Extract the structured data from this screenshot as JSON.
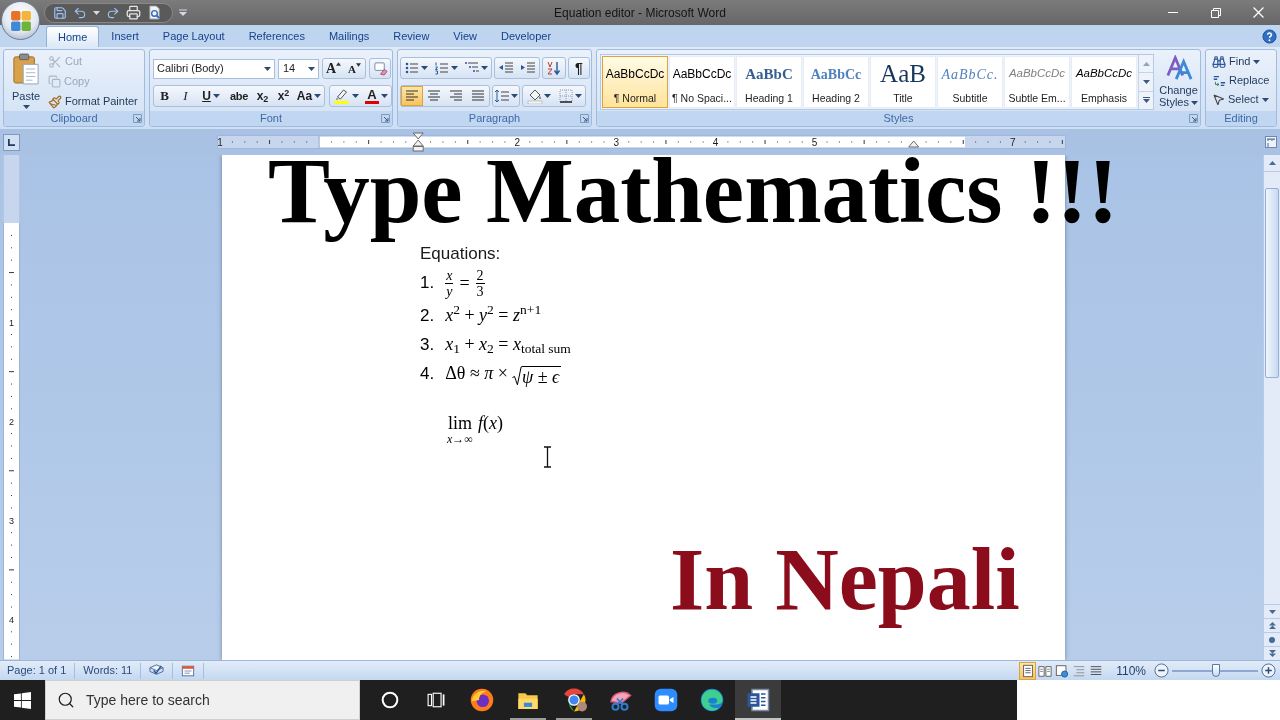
{
  "title_bar": {
    "title": "Equation editor - Microsoft Word"
  },
  "tabs": [
    {
      "label": "Home",
      "selected": true
    },
    {
      "label": "Insert",
      "selected": false
    },
    {
      "label": "Page Layout",
      "selected": false
    },
    {
      "label": "References",
      "selected": false
    },
    {
      "label": "Mailings",
      "selected": false
    },
    {
      "label": "Review",
      "selected": false
    },
    {
      "label": "View",
      "selected": false
    },
    {
      "label": "Developer",
      "selected": false
    }
  ],
  "clipboard": {
    "label": "Clipboard",
    "paste": "Paste",
    "actions": [
      {
        "kind": "cut",
        "label": "Cut",
        "disabled": true
      },
      {
        "kind": "copy",
        "label": "Copy",
        "disabled": true
      },
      {
        "kind": "painter",
        "label": "Format Painter",
        "disabled": false
      }
    ]
  },
  "font": {
    "label": "Font",
    "name": "Calibri (Body)",
    "size": "14",
    "grow": "A",
    "shrink": "A",
    "formats": [
      {
        "kind": "bold",
        "label": "B",
        "dropdown": false
      },
      {
        "kind": "italic",
        "label": "I",
        "dropdown": false
      },
      {
        "kind": "underline",
        "label": "U",
        "dropdown": true
      },
      {
        "kind": "strike",
        "label": "abe",
        "dropdown": false
      },
      {
        "kind": "plain",
        "label": "x$_{2}$",
        "dropdown": false
      },
      {
        "kind": "plain",
        "label": "x$^{2}$",
        "dropdown": false
      },
      {
        "kind": "plain",
        "label": "Aa",
        "dropdown": true
      }
    ],
    "font_color": "A"
  },
  "paragraph": {
    "label": "Paragraph",
    "marks": "¶",
    "alignments": [
      {
        "kind": "left",
        "selected": true
      },
      {
        "kind": "center",
        "selected": false
      },
      {
        "kind": "right",
        "selected": false
      },
      {
        "kind": "justify",
        "selected": false
      }
    ]
  },
  "styles": {
    "label": "Styles",
    "items": [
      {
        "kind": "body",
        "preview": "AaBbCcDc",
        "name": "¶ Normal",
        "selected": true
      },
      {
        "kind": "body",
        "preview": "AaBbCcDc",
        "name": "¶ No Spaci...",
        "selected": false
      },
      {
        "kind": "heading",
        "preview": "AaBbC",
        "name": "Heading 1",
        "selected": false
      },
      {
        "kind": "subheading",
        "preview": "AaBbCc",
        "name": "Heading 2",
        "selected": false
      },
      {
        "kind": "title",
        "preview": "AaB",
        "name": "Title",
        "selected": false
      },
      {
        "kind": "subtitle",
        "preview": "AaBbCc.",
        "name": "Subtitle",
        "selected": false
      },
      {
        "kind": "subtle",
        "preview": "AaBbCcDc",
        "name": "Subtle Em...",
        "selected": false
      },
      {
        "kind": "emphasis",
        "preview": "AaBbCcDc",
        "name": "Emphasis",
        "selected": false
      }
    ],
    "change": "Change Styles"
  },
  "editing": {
    "label": "Editing",
    "items": [
      {
        "kind": "find",
        "label": "Find",
        "dropdown": true
      },
      {
        "kind": "replace",
        "label": "Replace",
        "dropdown": false
      },
      {
        "kind": "select",
        "label": "Select",
        "dropdown": true
      }
    ]
  },
  "ruler": {
    "marks": [
      {
        "kind": "number",
        "label": "1"
      },
      {
        "kind": "margin"
      },
      {
        "kind": "indent"
      },
      {
        "kind": "number",
        "label": "2"
      },
      {
        "kind": "number",
        "label": "3"
      },
      {
        "kind": "number",
        "label": "4"
      },
      {
        "kind": "number",
        "label": "5"
      },
      {
        "kind": "rindent"
      },
      {
        "kind": "number",
        "label": "7"
      }
    ]
  },
  "vertical_ruler": {
    "labels": [
      "1",
      "2",
      "3",
      "4"
    ]
  },
  "document": {
    "title": "Type Mathematics !!!",
    "heading": "Equations:",
    "equations": [
      {
        "number": "1.",
        "kind": "fraction",
        "left": {
          "num": "x",
          "den": "y",
          "italic": true
        },
        "op": "=",
        "right": {
          "num": "2",
          "den": "3",
          "italic": false
        }
      },
      {
        "number": "2.",
        "kind": "inline",
        "text": "*x*$^{2}$ + *y*$^{2}$ = *z*$^{n+1}$"
      },
      {
        "number": "3.",
        "kind": "inline",
        "text": "*x*$_{1}$ + *x*$_{2}$ = *x*$_{total sum}$"
      },
      {
        "number": "4.",
        "kind": "radical",
        "text": "Δθ ≈ *π* ×",
        "radicand": "*ψ* ± *ϵ*"
      }
    ],
    "limit": {
      "operator": "lim",
      "under": "*x*→∞",
      "body": "*f*(*x*)"
    },
    "tagline": "In Nepali"
  },
  "status_bar": {
    "page": "Page: 1 of 1",
    "words": "Words: 11",
    "views": [
      {
        "kind": "print",
        "selected": true
      },
      {
        "kind": "reading",
        "selected": false
      },
      {
        "kind": "web",
        "selected": false
      },
      {
        "kind": "outline",
        "selected": false
      },
      {
        "kind": "draft",
        "selected": false
      }
    ],
    "zoom": {
      "label": "110%",
      "level": 0.51
    }
  },
  "taskbar": {
    "search": {
      "placeholder": "Type here to search"
    },
    "apps": [
      {
        "kind": "circle",
        "running": false,
        "selected": false
      },
      {
        "kind": "taskview",
        "running": false,
        "selected": false
      },
      {
        "kind": "fox",
        "running": false,
        "selected": false
      },
      {
        "kind": "folder",
        "running": true,
        "selected": false
      },
      {
        "kind": "ring",
        "running": true,
        "selected": false
      },
      {
        "kind": "scissors",
        "running": false,
        "selected": false
      },
      {
        "kind": "camera",
        "running": false,
        "selected": false
      },
      {
        "kind": "wave",
        "running": false,
        "selected": false
      },
      {
        "kind": "document",
        "running": true,
        "selected": true
      }
    ]
  }
}
